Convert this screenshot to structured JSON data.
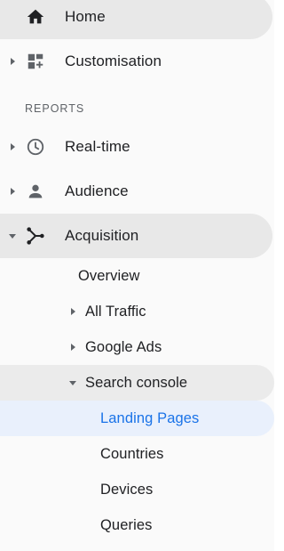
{
  "nav": {
    "home": {
      "label": "Home",
      "icon": "home-icon"
    },
    "customisation": {
      "label": "Customisation",
      "icon": "dashboard-add-icon"
    },
    "reports_header": "REPORTS",
    "realtime": {
      "label": "Real-time",
      "icon": "clock-icon"
    },
    "audience": {
      "label": "Audience",
      "icon": "person-icon"
    },
    "acquisition": {
      "label": "Acquisition",
      "icon": "acquisition-icon",
      "children": {
        "overview": "Overview",
        "all_traffic": "All Traffic",
        "google_ads": "Google Ads",
        "search_console": {
          "label": "Search console",
          "children": {
            "landing_pages": "Landing Pages",
            "countries": "Countries",
            "devices": "Devices",
            "queries": "Queries"
          }
        }
      }
    }
  },
  "colors": {
    "text": "#202124",
    "icon": "#5f6368",
    "active_text": "#1a73e8",
    "active_bg": "#e9f0fc",
    "selected_bg": "#e8e8e8"
  }
}
